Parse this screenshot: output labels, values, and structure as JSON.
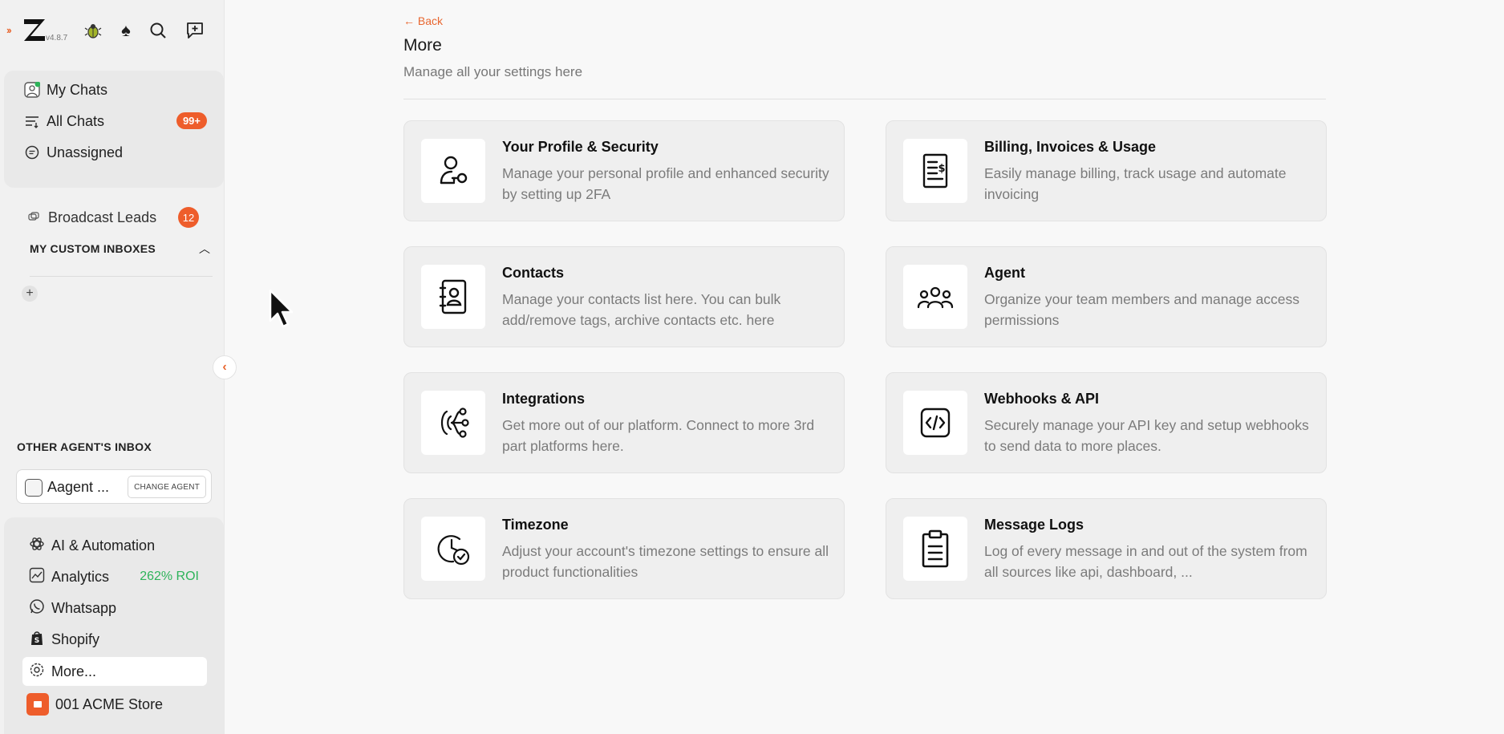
{
  "app": {
    "version": "v4.8.7"
  },
  "sidebar": {
    "nav_items": [
      {
        "label": "My Chats",
        "icon": "user-chat-icon"
      },
      {
        "label": "All Chats",
        "icon": "filter-list-icon",
        "badge": "99+"
      },
      {
        "label": "Unassigned",
        "icon": "chat-bubble-icon"
      }
    ],
    "broadcast": {
      "label": "Broadcast Leads",
      "badge": "12"
    },
    "custom_inboxes_title": "MY CUSTOM INBOXES",
    "other_inbox_title": "OTHER AGENT'S INBOX",
    "agent": {
      "name": "Aagent ...",
      "change_label": "CHANGE AGENT"
    },
    "bottom_items": [
      {
        "label": "AI & Automation",
        "icon": "openai-icon"
      },
      {
        "label": "Analytics",
        "icon": "chart-icon",
        "extra": "262% ROI"
      },
      {
        "label": "Whatsapp",
        "icon": "whatsapp-icon"
      },
      {
        "label": "Shopify",
        "icon": "shopify-icon"
      },
      {
        "label": "More...",
        "icon": "gear-icon",
        "active": true
      }
    ],
    "store": {
      "label": "001 ACME Store"
    }
  },
  "main": {
    "back_label": "Back",
    "title": "More",
    "subtitle": "Manage all your settings here",
    "cards": [
      {
        "title": "Your Profile & Security",
        "desc": "Manage your personal profile and enhanced security by setting up 2FA",
        "icon": "user-key-icon"
      },
      {
        "title": "Billing, Invoices & Usage",
        "desc": "Easily manage billing, track usage and automate invoicing",
        "icon": "invoice-icon"
      },
      {
        "title": "Contacts",
        "desc": "Manage your contacts list here. You can bulk add/remove tags, archive contacts etc. here",
        "icon": "contact-book-icon"
      },
      {
        "title": "Agent",
        "desc": "Organize your team members and manage access permissions",
        "icon": "team-icon"
      },
      {
        "title": "Integrations",
        "desc": "Get more out of our platform. Connect to more 3rd part platforms here.",
        "icon": "integration-icon"
      },
      {
        "title": "Webhooks & API",
        "desc": "Securely manage your API key and setup webhooks to send data to more places.",
        "icon": "code-icon"
      },
      {
        "title": "Timezone",
        "desc": "Adjust your account's timezone settings to ensure all product functionalities",
        "icon": "clock-check-icon"
      },
      {
        "title": "Message Logs",
        "desc": "Log of every message in and out of the system from all sources like api, dashboard, ...",
        "icon": "clipboard-icon"
      }
    ]
  },
  "colors": {
    "accent": "#ee5d2b",
    "roi_green": "#2eb35a",
    "sidebar_bg": "#f1f1f1",
    "card_bg": "#efefef"
  }
}
